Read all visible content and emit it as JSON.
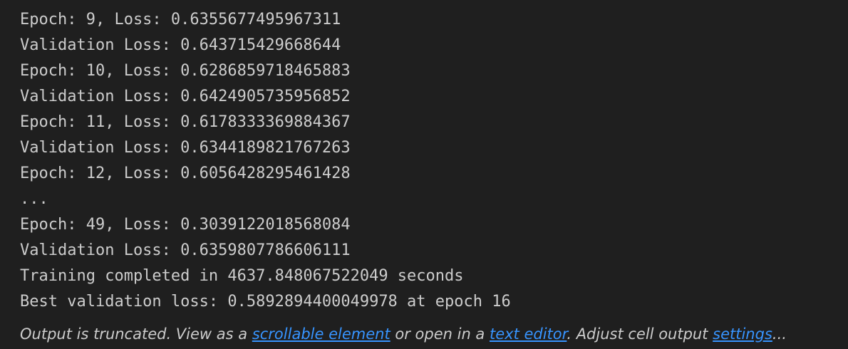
{
  "output": {
    "lines": [
      "Validation Loss: 0.6437154296686448",
      "Epoch: 9, Loss: 0.6355677495967311",
      "Validation Loss: 0.643715429668644",
      "Epoch: 10, Loss: 0.6286859718465883",
      "Validation Loss: 0.6424905735956852",
      "Epoch: 11, Loss: 0.6178333369884367",
      "Validation Loss: 0.6344189821767263",
      "Epoch: 12, Loss: 0.6056428295461428",
      "...",
      "Epoch: 49, Loss: 0.3039122018568084",
      "Validation Loss: 0.6359807786606111",
      "Training completed in 4637.848067522049 seconds",
      "Best validation loss: 0.5892894400049978 at epoch 16"
    ]
  },
  "footer": {
    "prefix": "Output is truncated. View as a ",
    "scrollable_link": "scrollable element",
    "middle": " or open in a ",
    "text_editor_link": "text editor",
    "after_editor": ". Adjust cell output ",
    "settings_link": "settings",
    "suffix": "..."
  },
  "colors": {
    "background": "#1f1f1f",
    "text": "#cccccc",
    "link": "#3794ff"
  }
}
